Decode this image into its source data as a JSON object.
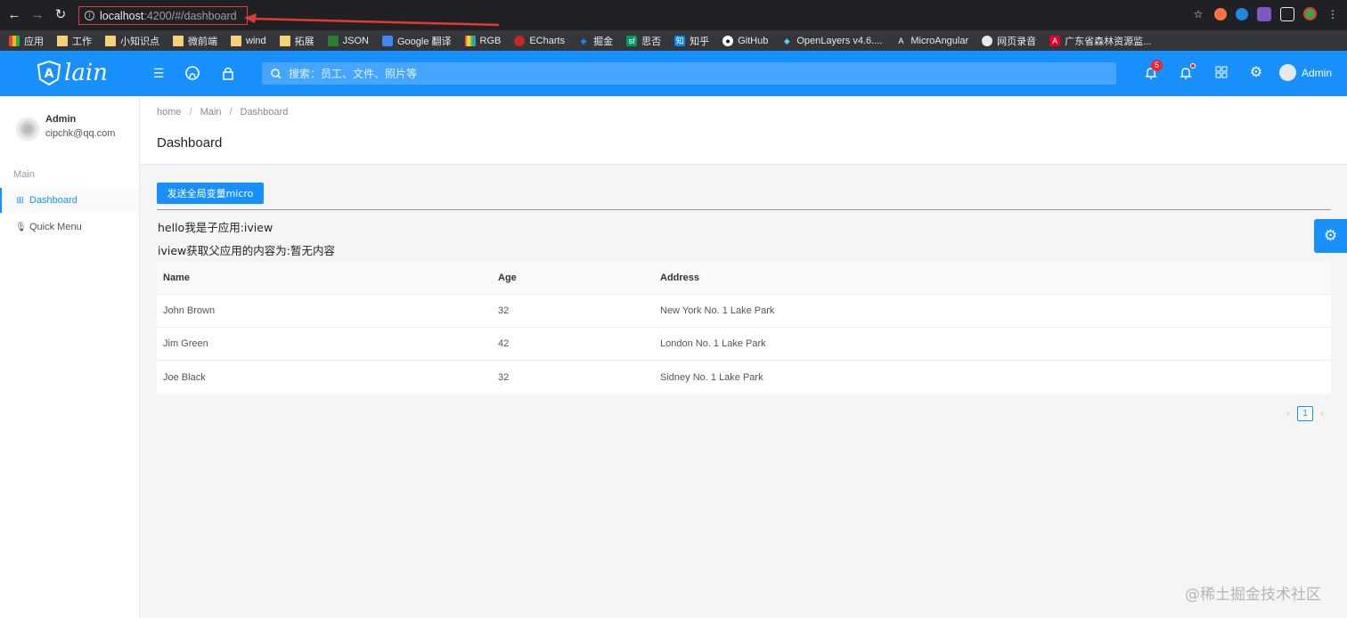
{
  "browser": {
    "url_host": "localhost",
    "url_path": ":4200/#/dashboard",
    "bookmarks": [
      {
        "label": "应用",
        "icon": "apps-grid-icon"
      },
      {
        "label": "工作",
        "icon": "folder-icon"
      },
      {
        "label": "小知识点",
        "icon": "folder-icon"
      },
      {
        "label": "微前端",
        "icon": "folder-icon"
      },
      {
        "label": "wind",
        "icon": "folder-icon"
      },
      {
        "label": "拓展",
        "icon": "folder-icon"
      },
      {
        "label": "JSON",
        "icon": "json-icon"
      },
      {
        "label": "Google 翻译",
        "icon": "translate-icon"
      },
      {
        "label": "RGB",
        "icon": "rainbow-icon"
      },
      {
        "label": "ECharts",
        "icon": "echarts-icon"
      },
      {
        "label": "掘金",
        "icon": "juejin-icon"
      },
      {
        "label": "思否",
        "icon": "segmentfault-icon"
      },
      {
        "label": "知乎",
        "icon": "zhihu-icon"
      },
      {
        "label": "GitHub",
        "icon": "github-icon"
      },
      {
        "label": "OpenLayers v4.6....",
        "icon": "openlayers-icon"
      },
      {
        "label": "MicroAngular",
        "icon": "angular-icon"
      },
      {
        "label": "网页录音",
        "icon": "globe-icon"
      },
      {
        "label": "广东省森林资源监...",
        "icon": "angular-icon"
      }
    ]
  },
  "header": {
    "logo_text": "lain",
    "search_placeholder": "搜索：员工、文件、照片等",
    "notification_count": "5",
    "user_name": "Admin"
  },
  "sidebar": {
    "user_name": "Admin",
    "user_email": "cipchk@qq.com",
    "group_label": "Main",
    "items": [
      {
        "label": "Dashboard",
        "icon": "dashboard-icon"
      },
      {
        "label": "Quick Menu",
        "icon": "microphone-icon"
      }
    ]
  },
  "page": {
    "breadcrumb": [
      "home",
      "Main",
      "Dashboard"
    ],
    "title": "Dashboard",
    "button_label": "发送全局变量micro",
    "line1": "hello我是子应用:iview",
    "line2": "iview获取父应用的内容为:暂无内容"
  },
  "table": {
    "headers": [
      "Name",
      "Age",
      "Address"
    ],
    "rows": [
      [
        "John Brown",
        "32",
        "New York No. 1 Lake Park"
      ],
      [
        "Jim Green",
        "42",
        "London No. 1 Lake Park"
      ],
      [
        "Joe Black",
        "32",
        "Sidney No. 1 Lake Park"
      ]
    ]
  },
  "pagination": {
    "current": "1"
  },
  "watermark": "@稀土掘金技术社区",
  "colors": {
    "primary": "#1890ff",
    "chrome": "#202124",
    "badge": "#f5222d"
  }
}
